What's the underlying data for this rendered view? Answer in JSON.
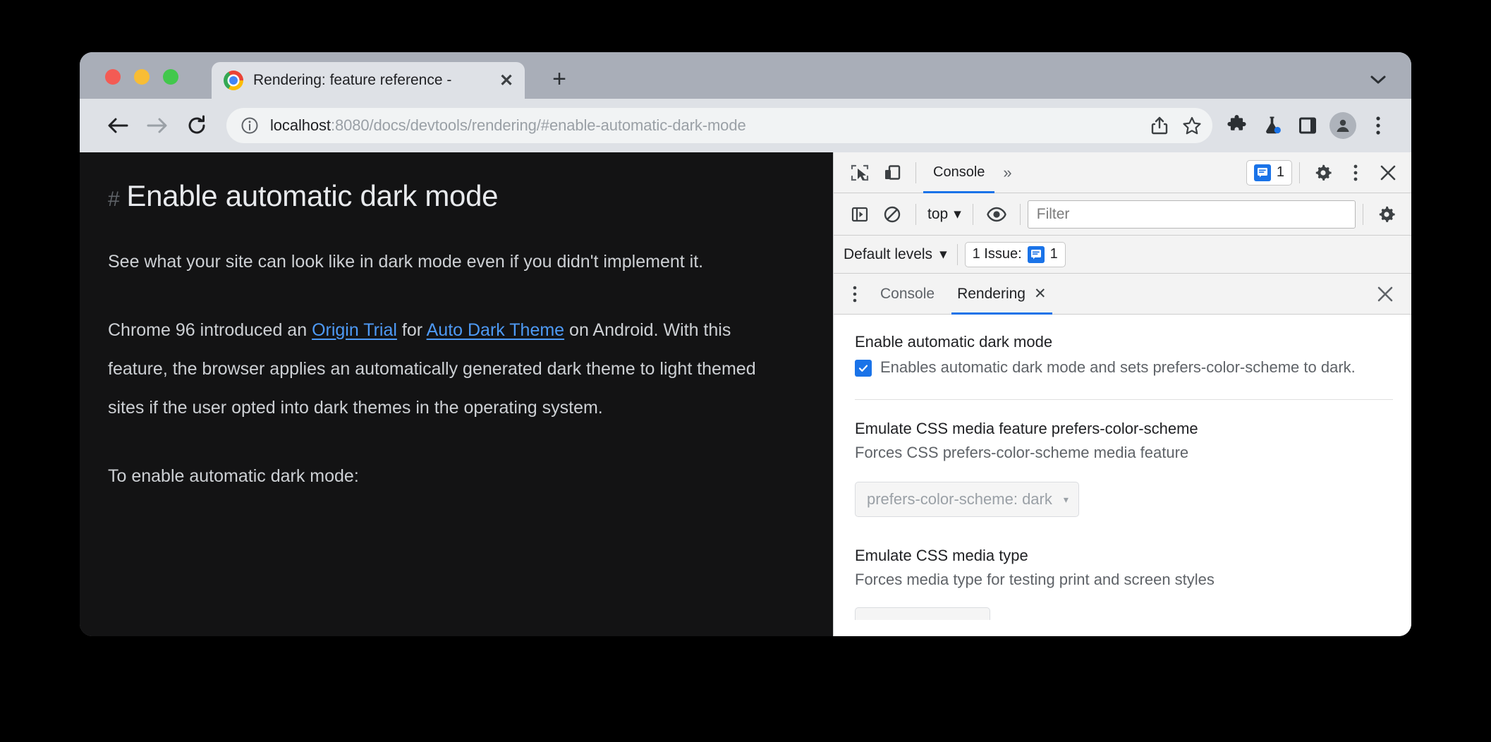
{
  "window": {
    "traffic_lights": [
      "close",
      "minimize",
      "maximize"
    ],
    "tab": {
      "title": "Rendering: feature reference - ",
      "close_label": "✕",
      "favicon": "chrome-logo"
    },
    "new_tab_label": "+",
    "tab_search_icon": "chevron-down-icon"
  },
  "navbar": {
    "back_icon": "back-arrow-icon",
    "forward_icon": "forward-arrow-icon",
    "reload_icon": "reload-icon",
    "site_info_icon": "info-circle-icon",
    "url_scheme_host": "localhost",
    "url_rest": ":8080/docs/devtools/rendering/#enable-automatic-dark-mode",
    "share_icon": "share-icon",
    "bookmark_icon": "star-icon",
    "extensions_icon": "puzzle-piece-icon",
    "experiments_icon": "flask-icon",
    "side_panel_icon": "side-panel-icon",
    "profile_icon": "avatar-icon",
    "menu_icon": "three-dot-menu-icon"
  },
  "page": {
    "heading_anchor": "#",
    "heading": "Enable automatic dark mode",
    "paragraph_1": "See what your site can look like in dark mode even if you didn't implement it.",
    "paragraph_2_pre": "Chrome 96 introduced an ",
    "link_1": "Origin Trial",
    "paragraph_2_mid": " for ",
    "link_2": "Auto Dark Theme",
    "paragraph_2_post": " on Android. With this feature, the browser applies an automatically generated dark theme to light themed sites if the user opted into dark themes in the operating system.",
    "paragraph_3": "To enable automatic dark mode:"
  },
  "devtools": {
    "main_toolbar": {
      "inspect_icon": "inspect-element-icon",
      "device_toolbar_icon": "device-toolbar-icon",
      "active_panel": "Console",
      "more_panels_icon": "»",
      "issues_count": "1",
      "issues_icon": "issue-icon",
      "settings_icon": "gear-icon",
      "more_options_icon": "three-dot-menu-icon",
      "close_icon": "close-icon"
    },
    "console_toolbar": {
      "sidebar_icon": "console-sidebar-icon",
      "clear_icon": "clear-console-icon",
      "context": "top",
      "context_caret": "▾",
      "eye_icon": "live-expression-icon",
      "filter_placeholder": "Filter",
      "filter_value": "",
      "settings_icon": "gear-icon"
    },
    "levels_toolbar": {
      "levels_label": "Default levels",
      "levels_caret": "▾",
      "issues_text": "1 Issue:",
      "issues_count": "1",
      "issue_icon": "issue-icon"
    },
    "drawer": {
      "kebab_icon": "three-dot-menu-icon",
      "tabs": [
        {
          "label": "Console",
          "active": false,
          "closable": false
        },
        {
          "label": "Rendering",
          "active": true,
          "closable": true,
          "close_label": "✕"
        }
      ],
      "close_icon": "close-icon",
      "close_label": "✕"
    },
    "rendering": {
      "settings": [
        {
          "title": "Enable automatic dark mode",
          "description": "Enables automatic dark mode and sets prefers-color-scheme to dark.",
          "checked": true,
          "check_glyph": "✓"
        },
        {
          "title": "Emulate CSS media feature prefers-color-scheme",
          "description": "Forces CSS prefers-color-scheme media feature",
          "select_value": "prefers-color-scheme: dark",
          "select_caret": "▾"
        },
        {
          "title": "Emulate CSS media type",
          "description": "Forces media type for testing print and screen styles"
        }
      ]
    }
  },
  "colors": {
    "accent_blue": "#1a73e8",
    "link_blue": "#4e9af5",
    "tabstrip_bg": "#a9aeb8",
    "toolbar_bg": "#dee1e6",
    "page_dark_bg": "#131314",
    "devtools_toolbar_bg": "#f3f3f3"
  }
}
